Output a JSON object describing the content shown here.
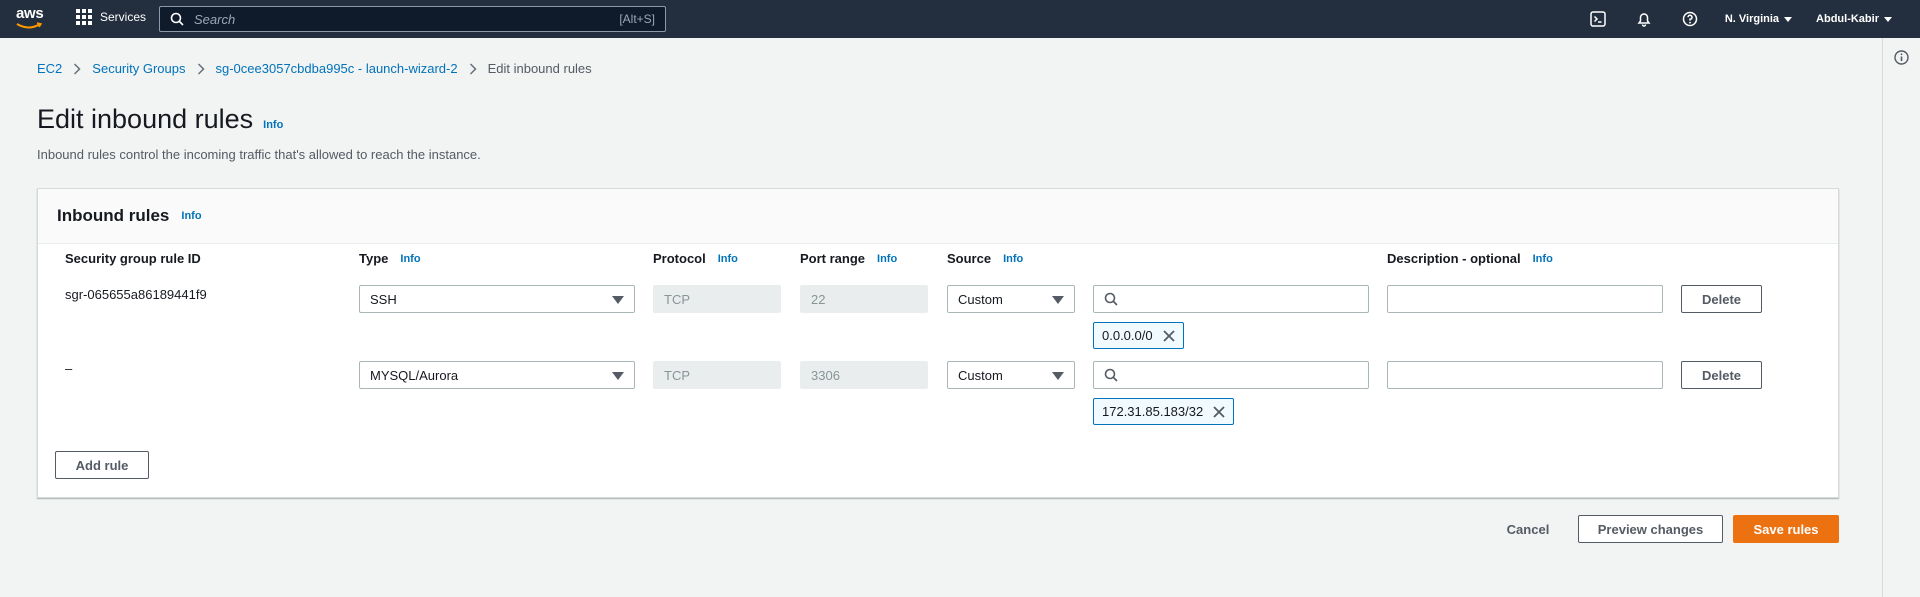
{
  "nav": {
    "logo": "aws",
    "services_label": "Services",
    "search_placeholder": "Search",
    "search_shortcut": "[Alt+S]",
    "region": "N. Virginia",
    "user": "Abdul-Kabir",
    "icons": [
      "cloudshell-icon",
      "bell-icon",
      "help-icon"
    ]
  },
  "breadcrumb": [
    {
      "label": "EC2"
    },
    {
      "label": "Security Groups"
    },
    {
      "label": "sg-0cee3057cbdba995c - launch-wizard-2"
    },
    {
      "label": "Edit inbound rules"
    }
  ],
  "page": {
    "title": "Edit inbound rules",
    "info": "Info",
    "description": "Inbound rules control the incoming traffic that's allowed to reach the instance."
  },
  "panel": {
    "title": "Inbound rules",
    "info": "Info",
    "columns": {
      "rule_id": "Security group rule ID",
      "type": "Type",
      "protocol": "Protocol",
      "port_range": "Port range",
      "source": "Source",
      "description": "Description - optional"
    },
    "rows": [
      {
        "rule_id": "sgr-065655a86189441f9",
        "type": "SSH",
        "protocol": "TCP",
        "port": "22",
        "source_type": "Custom",
        "source_token": "0.0.0.0/0",
        "description": "",
        "delete": "Delete"
      },
      {
        "rule_id": "–",
        "type": "MYSQL/Aurora",
        "protocol": "TCP",
        "port": "3306",
        "source_type": "Custom",
        "source_token": "172.31.85.183/32",
        "description": "",
        "delete": "Delete"
      }
    ],
    "add_rule": "Add rule"
  },
  "footer": {
    "cancel": "Cancel",
    "preview": "Preview changes",
    "save": "Save rules"
  },
  "colors": {
    "nav_bg": "#232f3e",
    "accent": "#ec7211",
    "link": "#0073bb"
  }
}
